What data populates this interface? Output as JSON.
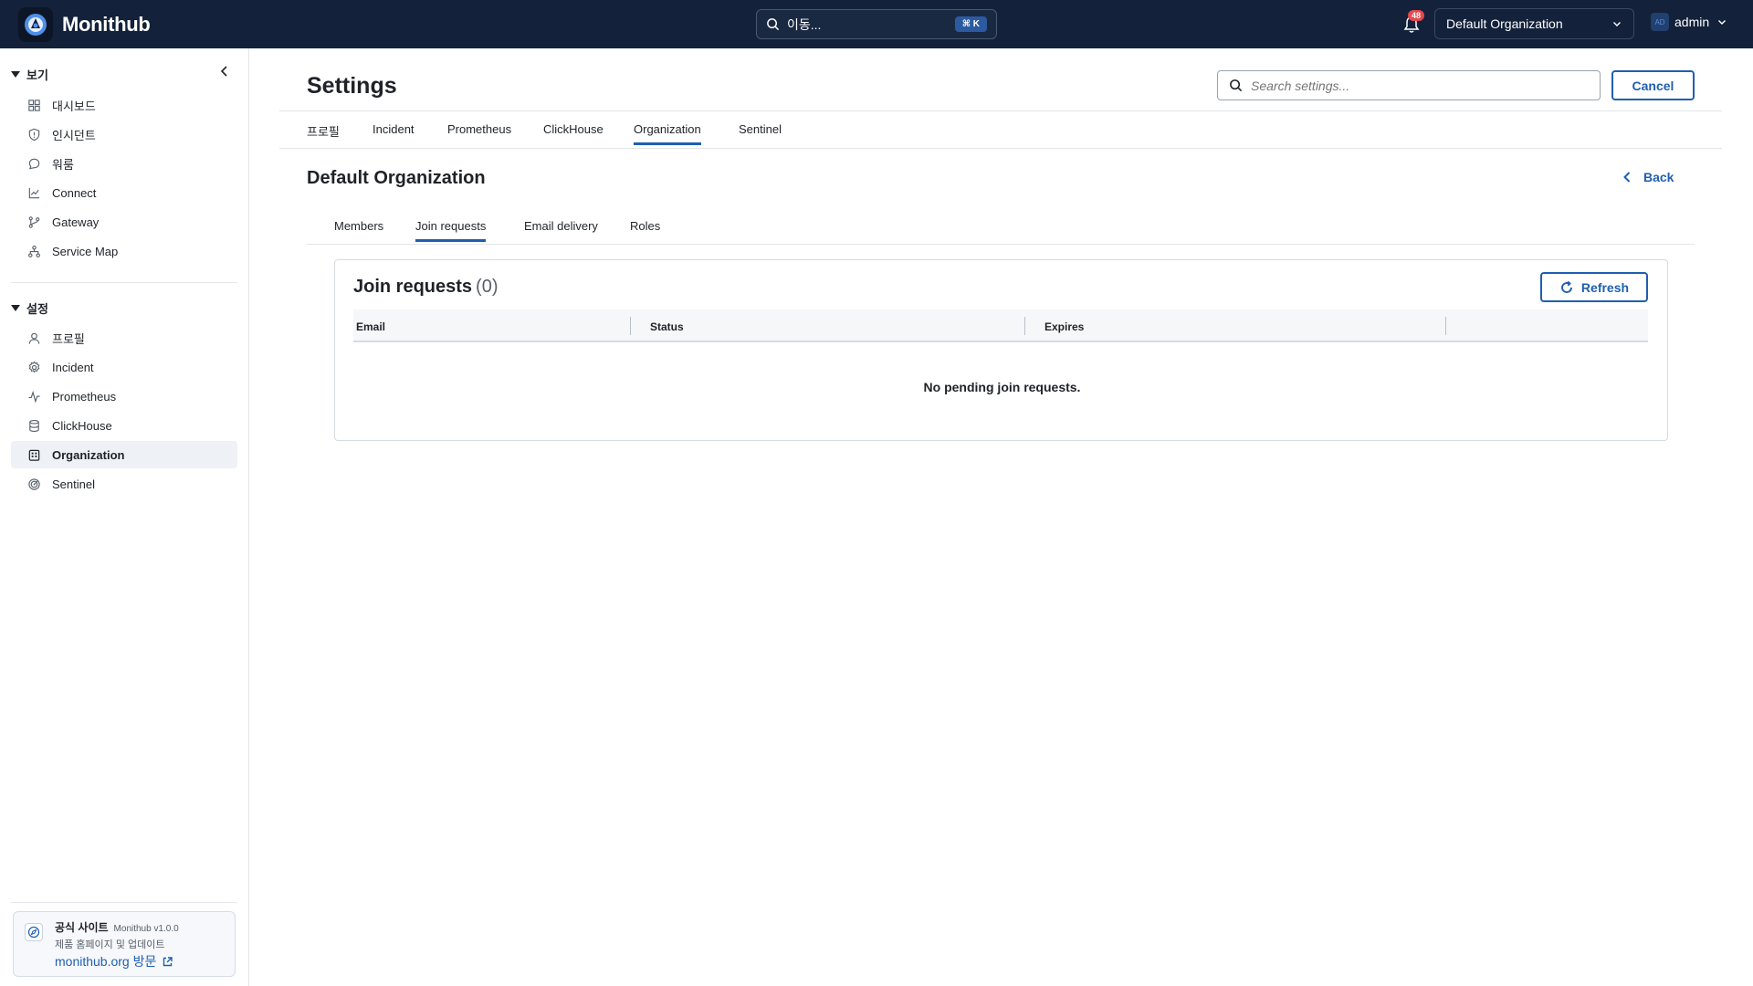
{
  "app": {
    "name": "Monithub"
  },
  "topbar": {
    "goto_label": "이동...",
    "goto_shortcut": "⌘ K",
    "notifications_count": "48",
    "organization": "Default Organization",
    "user_initials": "AD",
    "user_name": "admin"
  },
  "sidebar": {
    "view_section": "보기",
    "view_items": [
      {
        "label": "대시보드",
        "icon": "dashboard-icon"
      },
      {
        "label": "인시던트",
        "icon": "shield-icon"
      },
      {
        "label": "워룸",
        "icon": "chat-bubble-icon"
      },
      {
        "label": "Connect",
        "icon": "connect-chart-icon"
      },
      {
        "label": "Gateway",
        "icon": "git-branch-icon"
      },
      {
        "label": "Service Map",
        "icon": "sitemap-icon"
      }
    ],
    "settings_section": "설정",
    "settings_items": [
      {
        "label": "프로필",
        "icon": "user-icon"
      },
      {
        "label": "Incident",
        "icon": "gear-icon"
      },
      {
        "label": "Prometheus",
        "icon": "pulse-icon"
      },
      {
        "label": "ClickHouse",
        "icon": "database-icon"
      },
      {
        "label": "Organization",
        "icon": "building-icon",
        "active": true
      },
      {
        "label": "Sentinel",
        "icon": "radar-icon"
      }
    ],
    "promo": {
      "title": "공식 사이트",
      "version": "Monithub v1.0.0",
      "subtitle": "제품 홈페이지 및 업데이트",
      "link": "monithub.org 방문"
    }
  },
  "main": {
    "title": "Settings",
    "search_placeholder": "Search settings...",
    "cancel_label": "Cancel",
    "tabs": [
      "프로필",
      "Incident",
      "Prometheus",
      "ClickHouse",
      "Organization",
      "Sentinel"
    ],
    "active_tab": "Organization",
    "org_title": "Default Organization",
    "back_label": "Back",
    "sub_tabs": [
      "Members",
      "Join requests",
      "Email delivery",
      "Roles"
    ],
    "active_sub_tab": "Join requests",
    "card": {
      "title": "Join requests",
      "count": "(0)",
      "refresh_label": "Refresh",
      "columns": [
        "Email",
        "Status",
        "Expires"
      ],
      "empty_message": "No pending join requests."
    }
  },
  "colors": {
    "topbar_bg": "#13213a",
    "accent": "#1f5fb0",
    "badge": "#e5484d",
    "active_nav_bg": "#eef1f6"
  }
}
